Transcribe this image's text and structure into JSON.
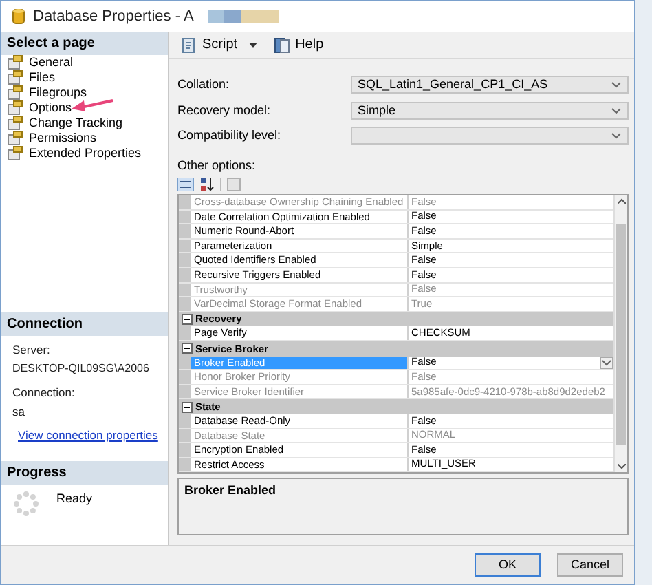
{
  "window": {
    "title": "Database Properties - A"
  },
  "sidebar": {
    "header": "Select a page",
    "items": [
      {
        "label": "General"
      },
      {
        "label": "Files"
      },
      {
        "label": "Filegroups"
      },
      {
        "label": "Options"
      },
      {
        "label": "Change Tracking"
      },
      {
        "label": "Permissions"
      },
      {
        "label": "Extended Properties"
      }
    ]
  },
  "connection": {
    "header": "Connection",
    "server_label": "Server:",
    "server": "DESKTOP-QIL09SG\\A2006",
    "connection_label": "Connection:",
    "connection": "sa",
    "link": "View connection properties"
  },
  "progress": {
    "header": "Progress",
    "status": "Ready"
  },
  "toolbar": {
    "script": "Script",
    "help": "Help"
  },
  "fields": [
    {
      "label": "Collation:",
      "value": "SQL_Latin1_General_CP1_CI_AS"
    },
    {
      "label": "Recovery model:",
      "value": "Simple"
    },
    {
      "label": "Compatibility level:"
    }
  ],
  "other_options_label": "Other options:",
  "grid": [
    {
      "kind": "property",
      "name": "Cross-database Ownership Chaining Enabled",
      "value": "False",
      "disabled": true,
      "selected": false
    },
    {
      "kind": "property",
      "name": "Date Correlation Optimization Enabled",
      "value": "False",
      "disabled": false,
      "selected": false
    },
    {
      "kind": "property",
      "name": "Numeric Round-Abort",
      "value": "False",
      "disabled": false,
      "selected": false
    },
    {
      "kind": "property",
      "name": "Parameterization",
      "value": "Simple",
      "disabled": false,
      "selected": false
    },
    {
      "kind": "property",
      "name": "Quoted Identifiers Enabled",
      "value": "False",
      "disabled": false,
      "selected": false
    },
    {
      "kind": "property",
      "name": "Recursive Triggers Enabled",
      "value": "False",
      "disabled": false,
      "selected": false
    },
    {
      "kind": "property",
      "name": "Trustworthy",
      "value": "False",
      "disabled": true,
      "selected": false
    },
    {
      "kind": "property",
      "name": "VarDecimal Storage Format Enabled",
      "value": "True",
      "disabled": true,
      "selected": false
    },
    {
      "kind": "category",
      "name": "Recovery",
      "expanded": true
    },
    {
      "kind": "property",
      "name": "Page Verify",
      "value": "CHECKSUM",
      "disabled": false,
      "selected": false
    },
    {
      "kind": "category",
      "name": "Service Broker",
      "expanded": true
    },
    {
      "kind": "property",
      "name": "Broker Enabled",
      "value": "False",
      "disabled": false,
      "selected": true
    },
    {
      "kind": "property",
      "name": "Honor Broker Priority",
      "value": "False",
      "disabled": true,
      "selected": false
    },
    {
      "kind": "property",
      "name": "Service Broker Identifier",
      "value": "5a985afe-0dc9-4210-978b-ab8d9d2edeb2",
      "disabled": true,
      "selected": false
    },
    {
      "kind": "category",
      "name": "State",
      "expanded": true
    },
    {
      "kind": "property",
      "name": "Database Read-Only",
      "value": "False",
      "disabled": false,
      "selected": false
    },
    {
      "kind": "property",
      "name": "Database State",
      "value": "NORMAL",
      "disabled": true,
      "selected": false
    },
    {
      "kind": "property",
      "name": "Encryption Enabled",
      "value": "False",
      "disabled": false,
      "selected": false
    },
    {
      "kind": "property",
      "name": "Restrict Access",
      "value": "MULTI_USER",
      "disabled": false,
      "selected": false
    }
  ],
  "description": {
    "title": "Broker Enabled"
  },
  "buttons": [
    {
      "label": "OK",
      "default": true
    },
    {
      "label": "Cancel",
      "default": false
    }
  ]
}
